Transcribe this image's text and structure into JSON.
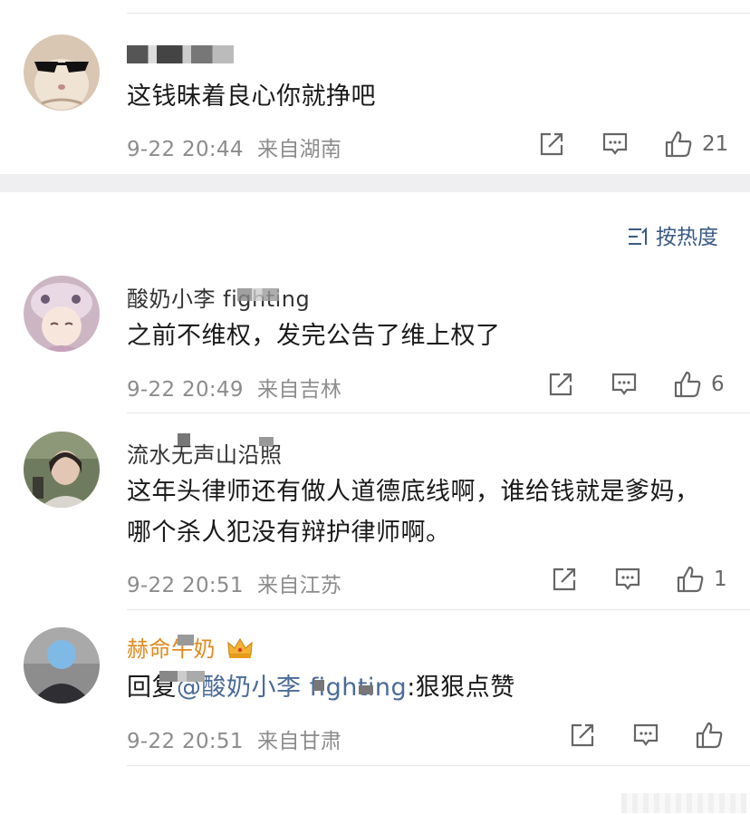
{
  "sort": {
    "label": "按热度"
  },
  "comments": [
    {
      "username": "",
      "text": "这钱昧着良心你就挣吧",
      "time": "9-22 20:44",
      "location": "来自湖南",
      "likes": "21"
    },
    {
      "username": "酸奶小李 fighting",
      "text": "之前不维权，发完公告了维上权了",
      "time": "9-22 20:49",
      "location": "来自吉林",
      "likes": "6"
    },
    {
      "username": "流水无声山沿照",
      "text": "这年头律师还有做人道德底线啊，谁给钱就是爹妈，哪个杀人犯没有辩护律师啊。",
      "time": "9-22 20:51",
      "location": "来自江苏",
      "likes": "1"
    },
    {
      "username": "赫命牛奶",
      "reply_prefix": "回复",
      "reply_mention": "@酸奶小李 fighting",
      "reply_text": ":狠狠点赞",
      "time": "9-22 20:51",
      "location": "来自甘肃",
      "likes": ""
    }
  ],
  "icons": [
    "share-icon",
    "comment-icon",
    "like-icon",
    "sort-icon",
    "crown-icon"
  ],
  "colors": {
    "mention": "#4a6a98",
    "vip_name": "#e08a1e",
    "meta": "#8c8c8c",
    "band": "#efeff2"
  }
}
